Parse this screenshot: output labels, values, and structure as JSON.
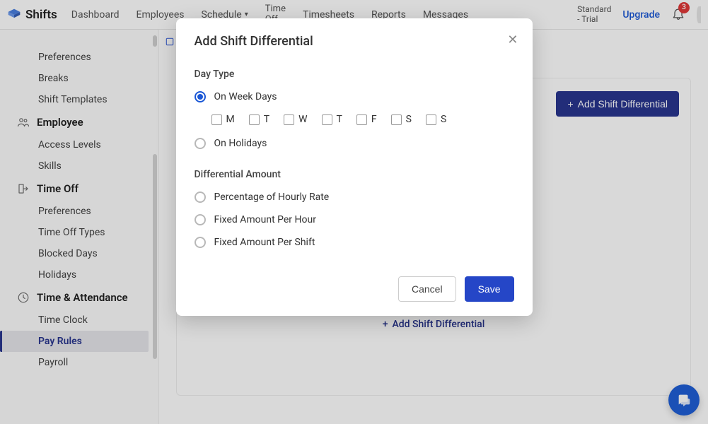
{
  "brand": "Shifts",
  "nav": {
    "dashboard": "Dashboard",
    "employees": "Employees",
    "schedule": "Schedule",
    "timeoff": "Time\nOff",
    "timesheets": "Timesheets",
    "reports": "Reports",
    "messages": "Messages"
  },
  "plan": {
    "line1": "Standard",
    "line2": "- Trial"
  },
  "upgrade": "Upgrade",
  "notif_count": "3",
  "sidebar": {
    "preferences": "Preferences",
    "breaks": "Breaks",
    "shift_templates": "Shift Templates",
    "group_employee": "Employee",
    "access_levels": "Access Levels",
    "skills": "Skills",
    "group_timeoff": "Time Off",
    "to_preferences": "Preferences",
    "to_types": "Time Off Types",
    "blocked_days": "Blocked Days",
    "holidays": "Holidays",
    "group_ta": "Time & Attendance",
    "time_clock": "Time Clock",
    "pay_rules": "Pay Rules",
    "payroll": "Payroll"
  },
  "content": {
    "add_btn": "Add Shift Differential",
    "add_link": "Add Shift Differential"
  },
  "modal": {
    "title": "Add Shift Differential",
    "day_type_label": "Day Type",
    "opt_weekdays": "On Week Days",
    "opt_holidays": "On Holidays",
    "days": [
      "M",
      "T",
      "W",
      "T",
      "F",
      "S",
      "S"
    ],
    "diff_amount_label": "Differential Amount",
    "opt_pct": "Percentage of Hourly Rate",
    "opt_fixed_hour": "Fixed Amount Per Hour",
    "opt_fixed_shift": "Fixed Amount Per Shift",
    "cancel": "Cancel",
    "save": "Save"
  }
}
